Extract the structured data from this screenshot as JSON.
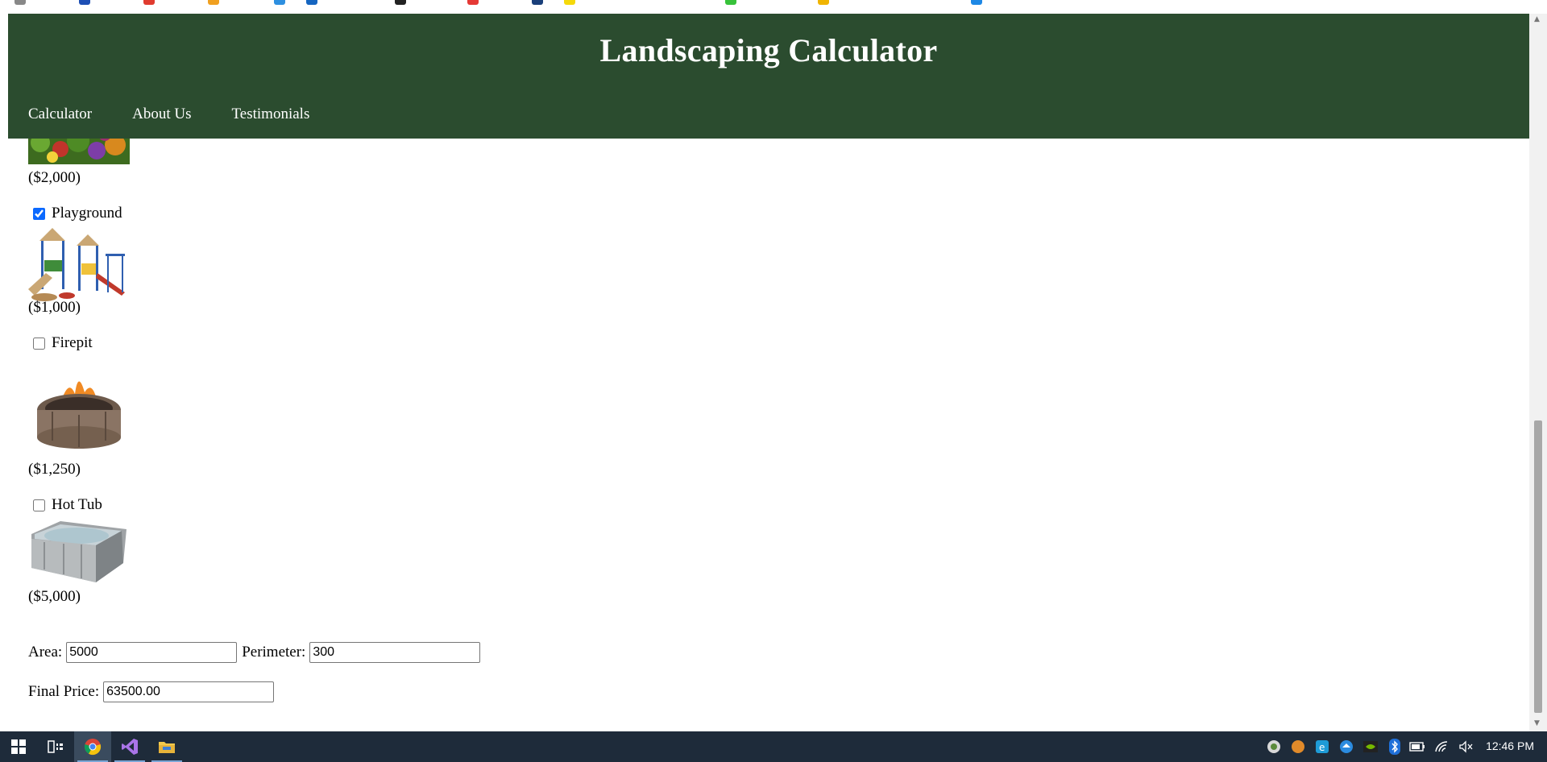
{
  "header": {
    "title": "Landscaping Calculator",
    "nav": [
      "Calculator",
      "About Us",
      "Testimonials"
    ]
  },
  "options": [
    {
      "label": "",
      "price": "($2,000)"
    },
    {
      "label": "Playground",
      "price": "($1,000)",
      "checked": true
    },
    {
      "label": "Firepit",
      "price": "($1,250)",
      "checked": false
    },
    {
      "label": "Hot Tub",
      "price": "($5,000)",
      "checked": false
    }
  ],
  "fields": {
    "area_label": "Area:",
    "area_value": "5000",
    "perimeter_label": "Perimeter:",
    "perimeter_value": "300",
    "final_price_label": "Final Price:",
    "final_price_value": "63500.00"
  },
  "taskbar": {
    "time": "12:46 PM"
  },
  "colors": {
    "header_bg": "#2b4c2f",
    "taskbar_bg": "#1e2b3a"
  }
}
